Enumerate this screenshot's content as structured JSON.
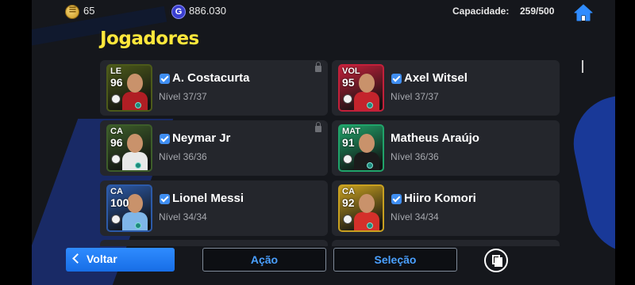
{
  "topbar": {
    "coins": "65",
    "gp": "886.030",
    "gp_icon_letter": "G",
    "capacity_label": "Capacidade:",
    "capacity_value": "259/500"
  },
  "title": "Jogadores",
  "players": [
    {
      "position": "LE",
      "rating": "96",
      "name": "A. Costacurta",
      "level": "Nível 37/37",
      "checked": true,
      "locked": true,
      "card_color": "#4c5a1a",
      "jersey_color": "#b01e24"
    },
    {
      "position": "VOL",
      "rating": "95",
      "name": "Axel Witsel",
      "level": "Nível 37/37",
      "checked": true,
      "locked": false,
      "card_color": "#c2203a",
      "jersey_color": "#c4242c"
    },
    {
      "position": "CA",
      "rating": "96",
      "name": "Neymar Jr",
      "level": "Nível 36/36",
      "checked": true,
      "locked": true,
      "card_color": "#3d5d2a",
      "jersey_color": "#e8e8e8"
    },
    {
      "position": "MAT",
      "rating": "91",
      "name": "Matheus Araújo",
      "level": "Nível 36/36",
      "checked": false,
      "locked": false,
      "card_color": "#20a36a",
      "jersey_color": "#1b1b1b"
    },
    {
      "position": "CA",
      "rating": "100",
      "name": "Lionel Messi",
      "level": "Nível 34/34",
      "checked": true,
      "locked": false,
      "card_color": "#2c5aa8",
      "jersey_color": "#7fb6e8"
    },
    {
      "position": "CA",
      "rating": "92",
      "name": "Hiiro Komori",
      "level": "Nível 34/34",
      "checked": true,
      "locked": false,
      "card_color": "#c8a020",
      "jersey_color": "#d4302a"
    }
  ],
  "buttons": {
    "back": "Voltar",
    "action": "Ação",
    "select": "Seleção"
  },
  "icons": {
    "coin": "coin-icon",
    "gp": "gp-icon",
    "home": "home-icon",
    "back": "chevron-left-icon",
    "cards": "cards-icon",
    "lock": "lock-icon",
    "check": "checkbox-icon"
  },
  "colors": {
    "title": "#ffe73b",
    "accent": "#2f8cff",
    "card_bg": "#24262c"
  }
}
